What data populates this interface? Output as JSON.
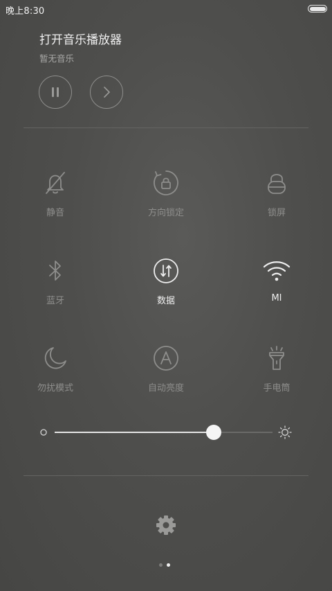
{
  "status_bar": {
    "time": "晚上8:30",
    "battery_icon": "battery-full-icon"
  },
  "music": {
    "title": "打开音乐播放器",
    "subtitle": "暂无音乐",
    "controls": [
      {
        "icon": "pause-icon"
      },
      {
        "icon": "next-chevron-icon"
      }
    ]
  },
  "toggles": [
    {
      "label": "静音",
      "icon": "bell-off-icon",
      "active": false
    },
    {
      "label": "方向锁定",
      "icon": "rotation-lock-icon",
      "active": false
    },
    {
      "label": "锁屏",
      "icon": "lock-icon",
      "active": false
    },
    {
      "label": "蓝牙",
      "icon": "bluetooth-icon",
      "active": false
    },
    {
      "label": "数据",
      "icon": "mobile-data-icon",
      "active": true
    },
    {
      "label": "MI",
      "icon": "wifi-icon",
      "active": true
    },
    {
      "label": "勿扰模式",
      "icon": "moon-icon",
      "active": false
    },
    {
      "label": "自动亮度",
      "icon": "auto-brightness-icon",
      "active": false
    },
    {
      "label": "手电筒",
      "icon": "flashlight-icon",
      "active": false
    }
  ],
  "brightness": {
    "level_percent": 73,
    "low_icon": "brightness-low-icon",
    "high_icon": "brightness-high-icon"
  },
  "footer": {
    "settings_icon": "gear-icon",
    "pages": 2,
    "active_page": 2
  },
  "colors": {
    "active": "#eeeeee",
    "inactive": "#8e8e8c",
    "background": "#4e4e4c"
  }
}
